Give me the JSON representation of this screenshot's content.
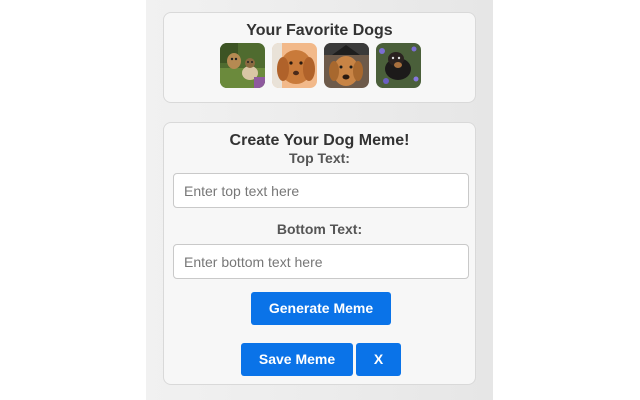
{
  "favorites": {
    "title": "Your Favorite Dogs",
    "thumbnails": [
      {
        "name": "dog-thumb-1"
      },
      {
        "name": "dog-thumb-2"
      },
      {
        "name": "dog-thumb-3"
      },
      {
        "name": "dog-thumb-4"
      }
    ]
  },
  "meme": {
    "title": "Create Your Dog Meme!",
    "top_label": "Top Text:",
    "top_placeholder": "Enter top text here",
    "bottom_label": "Bottom Text:",
    "bottom_placeholder": "Enter bottom text here",
    "generate_label": "Generate Meme",
    "save_label": "Save Meme",
    "close_label": "X"
  },
  "colors": {
    "accent": "#0a73e8",
    "card_bg": "#f7f7f7",
    "page_bg": "#ffffff"
  }
}
